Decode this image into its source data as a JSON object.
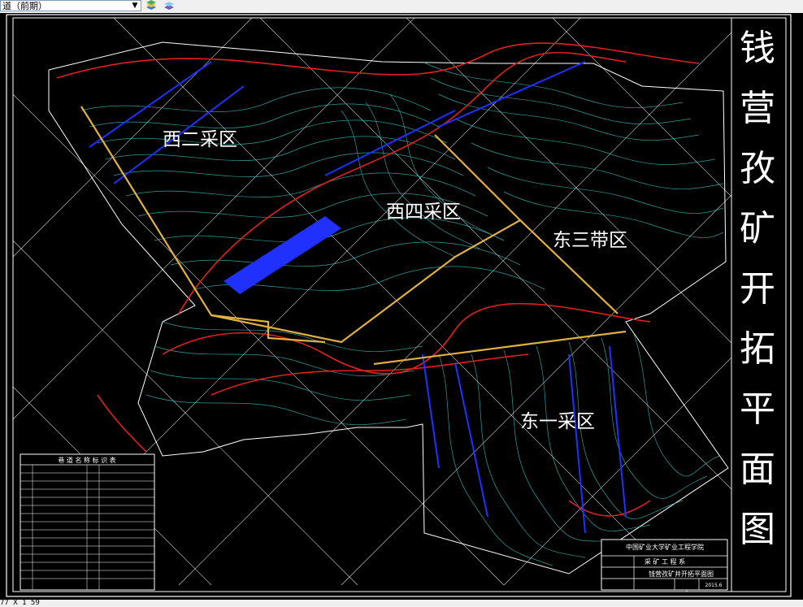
{
  "toolbar": {
    "layer_value": "道（前期）",
    "icons": [
      "layer-stack-icon",
      "layers-icon"
    ]
  },
  "drawing": {
    "vertical_title": [
      "钱",
      "营",
      "孜",
      "矿",
      "开",
      "拓",
      "平",
      "面",
      "图"
    ],
    "zones": {
      "west_two": "西二采区",
      "west_four": "西四采区",
      "east_three": "东三带区",
      "east_one": "东一采区"
    },
    "legend_title": "巷 道 名 称 标 识 表",
    "title_block": {
      "university": "中国矿业大学矿业工程学院",
      "department": "采 矿 工 程 系",
      "drawing_name": "钱营孜矿井开拓平面图",
      "date": "2015.6"
    },
    "colors": {
      "background": "#000000",
      "border": "#ffffff",
      "contour": "#40d0d0",
      "roadway": "#e0b040",
      "workings": "#2030ff",
      "fault": "#e02020"
    }
  },
  "status": {
    "coords": "77 X 1 59"
  }
}
